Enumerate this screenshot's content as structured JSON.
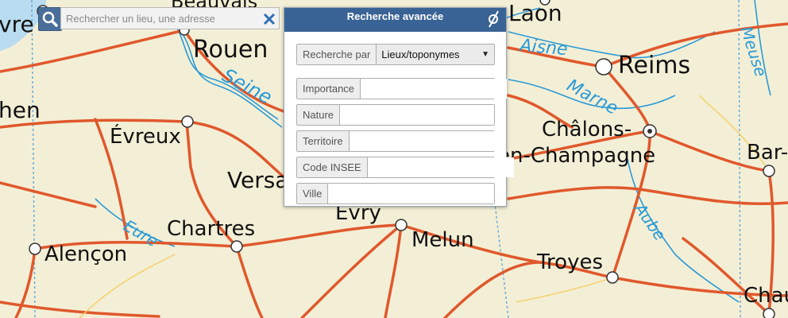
{
  "map": {
    "cities": [
      "Beauvais",
      "Laon",
      "Reims",
      "Rouen",
      "Évreux",
      "Châlons-",
      "en-Champagne",
      "Versa",
      "Évry",
      "Melun",
      "Chartres",
      "Alençon",
      "Troyes",
      "Bar-",
      "Chaum",
      "vre",
      "hen"
    ],
    "rivers": [
      "Seine",
      "Aisne",
      "Marne",
      "Meuse",
      "Aube",
      "Eure"
    ]
  },
  "search": {
    "placeholder": "Rechercher un lieu, une adresse",
    "icon": "search-icon",
    "clear_icon": "close-icon"
  },
  "advanced": {
    "title": "Recherche avancée",
    "close_icon": "hide-panel-icon",
    "search_by_label": "Recherche par",
    "search_by_value": "Lieux/toponymes",
    "fields": [
      "Importance",
      "Nature",
      "Territoire",
      "Code INSEE",
      "Ville"
    ]
  },
  "colors": {
    "land": "#f3efd6",
    "road": "#e0582c",
    "river": "#2a9ad6",
    "water": "#b9dcf0",
    "panel_header": "#3a6395"
  }
}
